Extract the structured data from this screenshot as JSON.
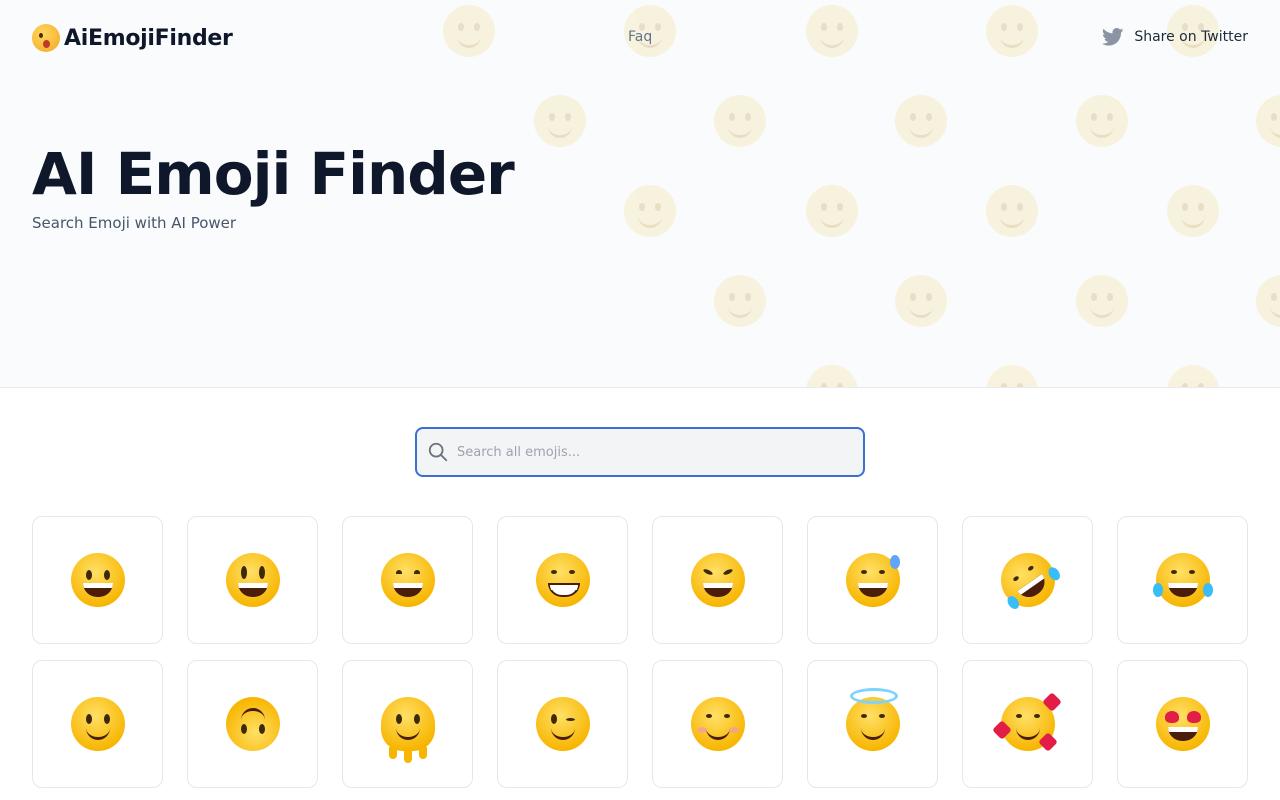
{
  "header": {
    "logo_text": "AiEmojiFinder",
    "nav_faq": "Faq",
    "share_label": "Share on Twitter"
  },
  "hero": {
    "title": "AI Emoji Finder",
    "subtitle": "Search Emoji with AI Power"
  },
  "search": {
    "placeholder": "Search all emojis...",
    "value": ""
  },
  "emojis": [
    "grinning-face",
    "grinning-face-with-big-eyes",
    "grinning-face-with-smiling-eyes",
    "beaming-face",
    "grinning-squinting-face",
    "grinning-face-with-sweat",
    "rolling-on-the-floor-laughing",
    "face-with-tears-of-joy",
    "slightly-smiling-face",
    "upside-down-face",
    "melting-face",
    "winking-face",
    "smiling-face-with-smiling-eyes",
    "smiling-face-with-halo",
    "smiling-face-with-hearts",
    "smiling-face-with-heart-eyes"
  ],
  "colors": {
    "accent": "#3b6fd4",
    "twitter_icon": "#8b94a3",
    "title": "#0f172a"
  }
}
